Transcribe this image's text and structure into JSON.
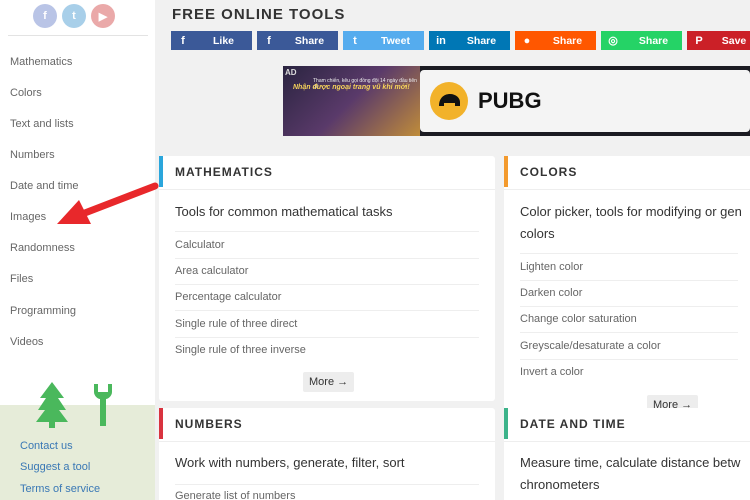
{
  "sidebar": {
    "social": [
      {
        "icon": "facebook-icon",
        "glyph": "f",
        "color": "#b9c4e6"
      },
      {
        "icon": "twitter-icon",
        "glyph": "t",
        "color": "#a8cfe9"
      },
      {
        "icon": "youtube-icon",
        "glyph": "▶",
        "color": "#eaa9a9"
      }
    ],
    "items": [
      {
        "label": "Mathematics"
      },
      {
        "label": "Colors"
      },
      {
        "label": "Text and lists"
      },
      {
        "label": "Numbers"
      },
      {
        "label": "Date and time"
      },
      {
        "label": "Images"
      },
      {
        "label": "Randomness"
      },
      {
        "label": "Files"
      },
      {
        "label": "Programming"
      },
      {
        "label": "Videos"
      }
    ],
    "footer_links": [
      "Contact us",
      "Suggest a tool",
      "Terms of service"
    ],
    "footer_bg": "#e6ecd9",
    "icon_color": "#4ab85c"
  },
  "header": {
    "title": "FREE ONLINE TOOLS",
    "share_buttons": [
      {
        "label": "Like",
        "icon": "facebook-icon",
        "glyph": "f",
        "color": "#3b5998"
      },
      {
        "label": "Share",
        "icon": "facebook-icon",
        "glyph": "f",
        "color": "#3b5998"
      },
      {
        "label": "Tweet",
        "icon": "twitter-icon",
        "glyph": "t",
        "color": "#55acee"
      },
      {
        "label": "Share",
        "icon": "linkedin-icon",
        "glyph": "in",
        "color": "#0077b5"
      },
      {
        "label": "Share",
        "icon": "reddit-icon",
        "glyph": "●",
        "color": "#ff5700"
      },
      {
        "label": "Share",
        "icon": "whatsapp-icon",
        "glyph": "◎",
        "color": "#25d366"
      },
      {
        "label": "Save",
        "icon": "pinterest-icon",
        "glyph": "P",
        "color": "#cb2027"
      }
    ]
  },
  "ad": {
    "badge": "AD",
    "small_text": "Tham chiến, kêu gọi đồng đội 14 ngày đầu tiên để",
    "headline": "Nhận được ngoại trang vũ khí mới!",
    "brand": "PUBG"
  },
  "cards": [
    {
      "title": "MATHEMATICS",
      "accent": "#2aa6dc",
      "desc": [
        "Tools for common mathematical tasks"
      ],
      "links": [
        "Calculator",
        "Area calculator",
        "Percentage calculator",
        "Single rule of three direct",
        "Single rule of three inverse"
      ],
      "more": "More →"
    },
    {
      "title": "COLORS",
      "accent": "#f39a2d",
      "desc": [
        "Color picker, tools for modifying or gen",
        "colors"
      ],
      "links": [
        "Lighten color",
        "Darken color",
        "Change color saturation",
        "Greyscale/desaturate a color",
        "Invert a color"
      ],
      "more": "More →"
    },
    {
      "title": "NUMBERS",
      "accent": "#d9333f",
      "desc": [
        "Work with numbers, generate, filter, sort"
      ],
      "links": [
        "Generate list of numbers"
      ]
    },
    {
      "title": "DATE AND TIME",
      "accent": "#3cb38a",
      "desc": [
        "Measure time, calculate distance betw",
        "chronometers"
      ],
      "links": []
    }
  ]
}
